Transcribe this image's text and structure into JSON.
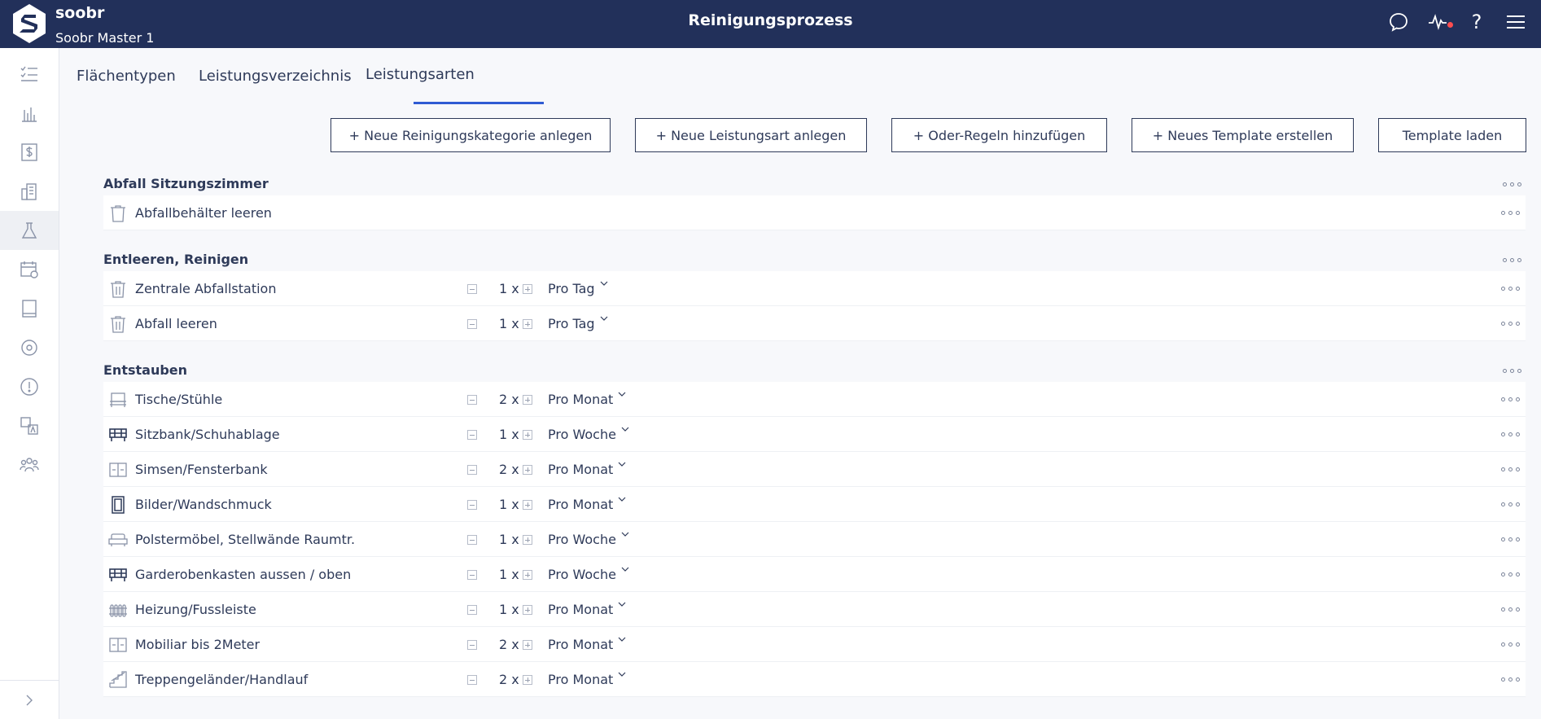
{
  "app": {
    "name": "soobr",
    "subtitle": "Soobr Master 1",
    "page_title": "Reinigungsprozess"
  },
  "header_icons": [
    "chat-icon",
    "activity-icon",
    "help-icon",
    "menu-icon"
  ],
  "help_symbol": "?",
  "sidebar": {
    "items": [
      "checklist-icon",
      "chart-icon",
      "dollar-icon",
      "buildings-icon",
      "flask-icon",
      "calendar-icon",
      "book-icon",
      "target-icon",
      "alert-icon",
      "translate-icon",
      "team-icon"
    ],
    "active_index": 4
  },
  "tabs": [
    {
      "label": "Flächentypen"
    },
    {
      "label": "Leistungsverzeichnis"
    },
    {
      "label": "Leistungsarten",
      "active": true
    }
  ],
  "toolbar": {
    "new_category": "+ Neue Reinigungskategorie anlegen",
    "new_service_type": "+ Neue Leistungsart anlegen",
    "add_or_rules": "+ Oder-Regeln hinzufügen",
    "new_template": "+ Neues Template erstellen",
    "load_template": "Template laden"
  },
  "categories": [
    {
      "title": "Abfall Sitzungszimmer",
      "items": [
        {
          "label": "Abfallbehälter leeren",
          "icon": "trash-icon"
        }
      ]
    },
    {
      "title": "Entleeren, Reinigen",
      "items": [
        {
          "label": "Zentrale Abfallstation",
          "icon": "trash-icon",
          "qty": "1 x",
          "freq": "Pro Tag"
        },
        {
          "label": "Abfall leeren",
          "icon": "trash-icon",
          "qty": "1 x",
          "freq": "Pro Tag"
        }
      ]
    },
    {
      "title": "Entstauben",
      "items": [
        {
          "label": "Tische/Stühle",
          "icon": "table-icon",
          "qty": "2 x",
          "freq": "Pro Monat"
        },
        {
          "label": "Sitzbank/Schuhablage",
          "icon": "bench-icon",
          "qty": "1 x",
          "freq": "Pro Woche"
        },
        {
          "label": "Simsen/Fensterbank",
          "icon": "windowsill-icon",
          "qty": "2 x",
          "freq": "Pro Monat"
        },
        {
          "label": "Bilder/Wandschmuck",
          "icon": "picture-icon",
          "qty": "1 x",
          "freq": "Pro Monat"
        },
        {
          "label": "Polstermöbel, Stellwände Raumtr.",
          "icon": "sofa-icon",
          "qty": "1 x",
          "freq": "Pro Woche"
        },
        {
          "label": "Garderobenkasten aussen / oben",
          "icon": "bench-icon",
          "qty": "1 x",
          "freq": "Pro Woche"
        },
        {
          "label": "Heizung/Fussleiste",
          "icon": "radiator-icon",
          "qty": "1 x",
          "freq": "Pro Monat"
        },
        {
          "label": "Mobiliar bis 2Meter",
          "icon": "windowsill-icon",
          "qty": "2 x",
          "freq": "Pro Monat"
        },
        {
          "label": "Treppengeländer/Handlauf",
          "icon": "stairs-icon",
          "qty": "2 x",
          "freq": "Pro Monat"
        }
      ]
    }
  ]
}
